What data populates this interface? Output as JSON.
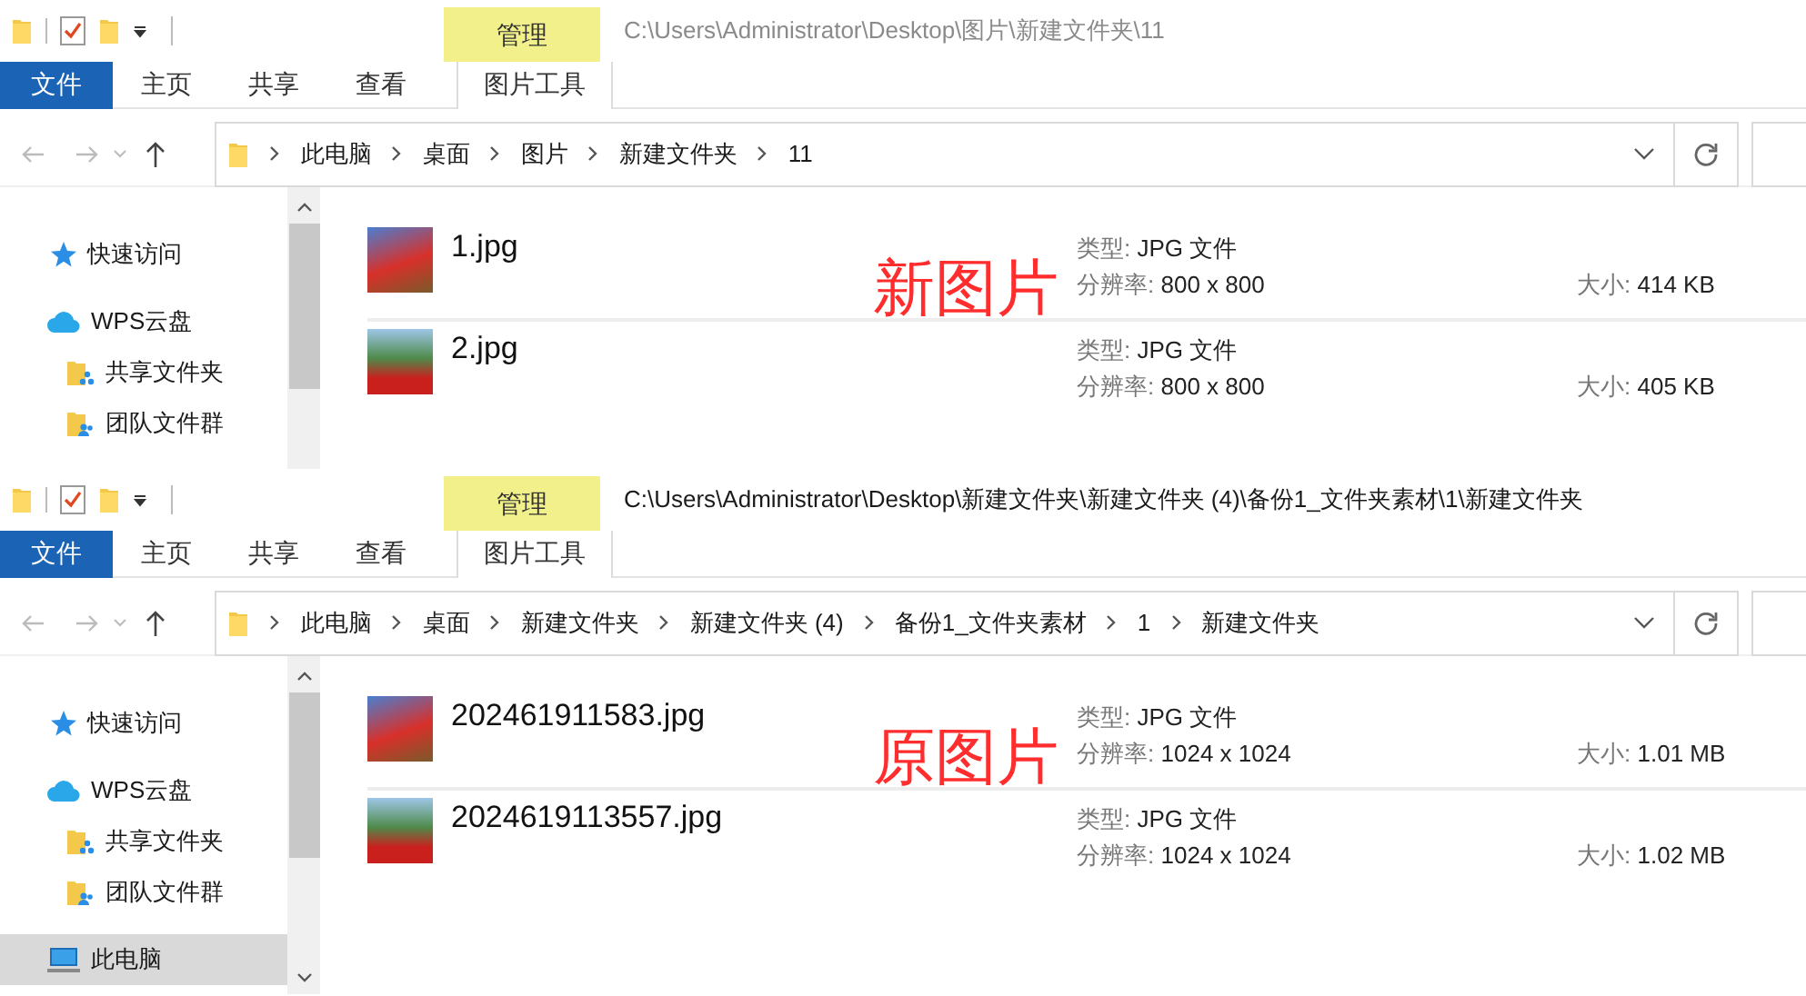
{
  "windows": [
    {
      "title": "C:\\Users\\Administrator\\Desktop\\图片\\新建文件夹\\11",
      "active": false,
      "context_group": "管理",
      "tabs": [
        {
          "label": "文件",
          "kind": "file"
        },
        {
          "label": "主页",
          "kind": "plain"
        },
        {
          "label": "共享",
          "kind": "plain"
        },
        {
          "label": "查看",
          "kind": "plain"
        },
        {
          "label": "图片工具",
          "kind": "context"
        }
      ],
      "breadcrumb": [
        "此电脑",
        "桌面",
        "图片",
        "新建文件夹",
        "11"
      ],
      "sidebar": [
        {
          "label": "快速访问",
          "kind": "star",
          "selected": false
        },
        {
          "label": "WPS云盘",
          "kind": "cloud",
          "selected": false,
          "children": [
            {
              "label": "共享文件夹",
              "kind": "shared",
              "selected": false
            },
            {
              "label": "团队文件群",
              "kind": "team",
              "selected": false
            }
          ]
        }
      ],
      "files": [
        {
          "name": "1.jpg",
          "type_label": "类型:",
          "type": "JPG 文件",
          "resolution_label": "分辨率:",
          "resolution": "800 x 800",
          "size_label": "大小:",
          "size": "414 KB"
        },
        {
          "name": "2.jpg",
          "type_label": "类型:",
          "type": "JPG 文件",
          "resolution_label": "分辨率:",
          "resolution": "800 x 800",
          "size_label": "大小:",
          "size": "405 KB"
        }
      ],
      "annotation": "新图片"
    },
    {
      "title": "C:\\Users\\Administrator\\Desktop\\新建文件夹\\新建文件夹 (4)\\备份1_文件夹素材\\1\\新建文件夹",
      "active": true,
      "context_group": "管理",
      "tabs": [
        {
          "label": "文件",
          "kind": "file"
        },
        {
          "label": "主页",
          "kind": "plain"
        },
        {
          "label": "共享",
          "kind": "plain"
        },
        {
          "label": "查看",
          "kind": "plain"
        },
        {
          "label": "图片工具",
          "kind": "context"
        }
      ],
      "breadcrumb": [
        "此电脑",
        "桌面",
        "新建文件夹",
        "新建文件夹 (4)",
        "备份1_文件夹素材",
        "1",
        "新建文件夹"
      ],
      "sidebar": [
        {
          "label": "快速访问",
          "kind": "star",
          "selected": false
        },
        {
          "label": "WPS云盘",
          "kind": "cloud",
          "selected": false,
          "children": [
            {
              "label": "共享文件夹",
              "kind": "shared",
              "selected": false
            },
            {
              "label": "团队文件群",
              "kind": "team",
              "selected": false
            }
          ]
        },
        {
          "label": "此电脑",
          "kind": "pc",
          "selected": true
        }
      ],
      "files": [
        {
          "name": "202461911583.jpg",
          "type_label": "类型:",
          "type": "JPG 文件",
          "resolution_label": "分辨率:",
          "resolution": "1024 x 1024",
          "size_label": "大小:",
          "size": "1.01 MB"
        },
        {
          "name": "2024619113557.jpg",
          "type_label": "类型:",
          "type": "JPG 文件",
          "resolution_label": "分辨率:",
          "resolution": "1024 x 1024",
          "size_label": "大小:",
          "size": "1.02 MB"
        }
      ],
      "annotation": "原图片"
    }
  ]
}
